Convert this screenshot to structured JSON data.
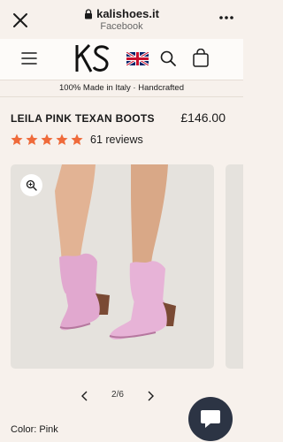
{
  "browser": {
    "url": "kalishoes.it",
    "source": "Facebook",
    "close_icon": "close-icon",
    "lock_icon": "lock-icon",
    "more_icon": "more-icon"
  },
  "header": {
    "logo_text": "KS",
    "icons": [
      "menu-icon",
      "uk-flag-icon",
      "search-icon",
      "cart-icon"
    ]
  },
  "announcement": "100% Made in Italy · Handcrafted",
  "product": {
    "title": "LEILA PINK TEXAN BOOTS",
    "price": "£146.00",
    "rating_stars": 5,
    "reviews": "61 reviews",
    "color_label": "Color: Pink"
  },
  "gallery": {
    "counter": "2/6",
    "zoom_icon": "zoom-icon",
    "prev_icon": "chevron-left-icon",
    "next_icon": "chevron-right-icon"
  },
  "colors": {
    "page_bg": "#f7f1ec",
    "header_bg": "#fdfbf9",
    "star": "#ef6a3a",
    "image_bg": "#e5e2dd",
    "boot_pink": "#e1a8cf",
    "chat_bg": "#2c3444"
  }
}
